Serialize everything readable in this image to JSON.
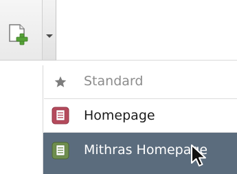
{
  "toolbar": {
    "new_button_icon": "new-document-plus-icon",
    "dropdown_icon": "chevron-down-icon"
  },
  "menu": {
    "items": [
      {
        "label": "Standard",
        "icon": "star-icon",
        "state": "disabled"
      },
      {
        "label": "Homepage",
        "icon": "homepage-red-icon",
        "state": "normal"
      },
      {
        "label": "Mithras Homepage",
        "icon": "homepage-green-icon",
        "state": "hovered"
      }
    ]
  },
  "colors": {
    "hover_background": "#5b6c7d",
    "disabled_text": "#8c8c8c",
    "homepage_icon": "#b54a5c",
    "mithras_icon": "#6f8e4e"
  },
  "cursor": "arrow-cursor-icon"
}
